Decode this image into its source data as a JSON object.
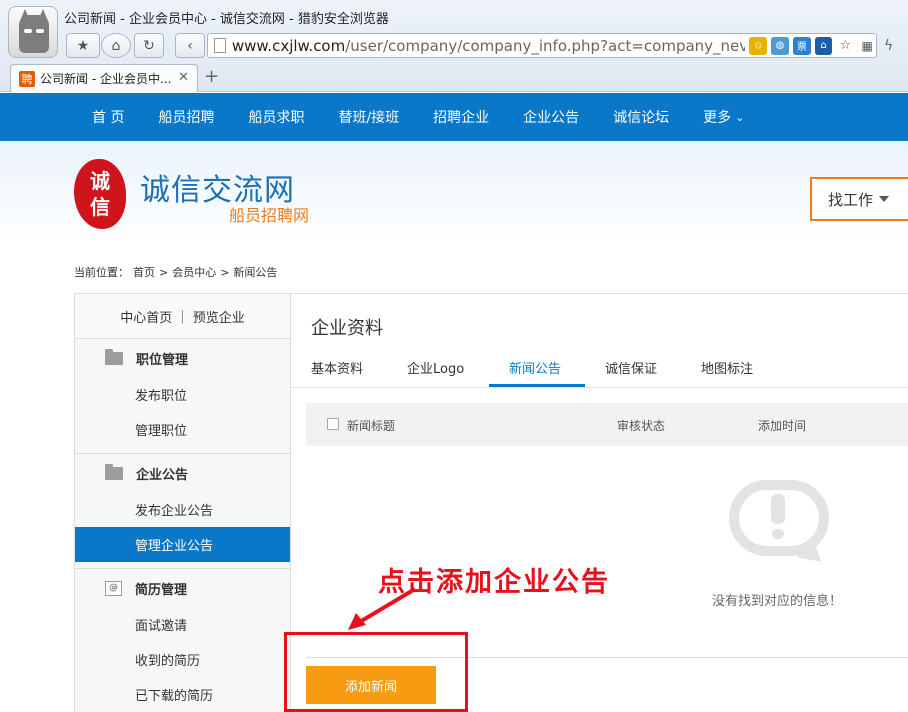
{
  "browser": {
    "window_title": "公司新闻 - 企业会员中心 - 诚信交流网 - 猎豹安全浏览器",
    "url_domain": "www.cxjlw.com",
    "url_path": "/user/company/company_info.php?act=company_nev",
    "tab_title": "公司新闻 - 企业会员中...",
    "tab_favicon_text": "聘",
    "ext_ticket_text": "票"
  },
  "nav": {
    "items": [
      "首 页",
      "船员招聘",
      "船员求职",
      "替班/接班",
      "招聘企业",
      "企业公告",
      "诚信论坛"
    ],
    "more": "更多"
  },
  "header": {
    "seal_top": "诚",
    "seal_bottom": "信",
    "logo_main": "诚信交流网",
    "logo_sub": "船员招聘网",
    "find_job": "找工作"
  },
  "breadcrumb": {
    "label": "当前位置：",
    "items": [
      "首页",
      "会员中心",
      "新闻公告"
    ],
    "sep": ">"
  },
  "sidebar": {
    "top_home": "中心首页",
    "top_sep": "|",
    "top_preview": "预览企业",
    "groups": [
      {
        "title": "职位管理",
        "items": [
          "发布职位",
          "管理职位"
        ]
      },
      {
        "title": "企业公告",
        "items": [
          "发布企业公告",
          "管理企业公告"
        ]
      },
      {
        "title": "简历管理",
        "items": [
          "面试邀请",
          "收到的简历",
          "已下载的简历"
        ]
      }
    ],
    "resume_icon_text": "@"
  },
  "main": {
    "title": "企业资料",
    "tabs": [
      "基本资料",
      "企业Logo",
      "新闻公告",
      "诚信保证",
      "地图标注"
    ],
    "active_tab": "新闻公告",
    "columns": [
      "新闻标题",
      "审核状态",
      "添加时间"
    ],
    "empty_text": "没有找到对应的信息！",
    "add_button": "添加新闻"
  },
  "annotation": {
    "text": "点击添加企业公告",
    "color": "#e8101a"
  },
  "colors": {
    "nav_blue": "#0a78c8",
    "orange": "#f79b12",
    "logo_orange": "#ef7b1c",
    "seal_red": "#d0141b"
  }
}
